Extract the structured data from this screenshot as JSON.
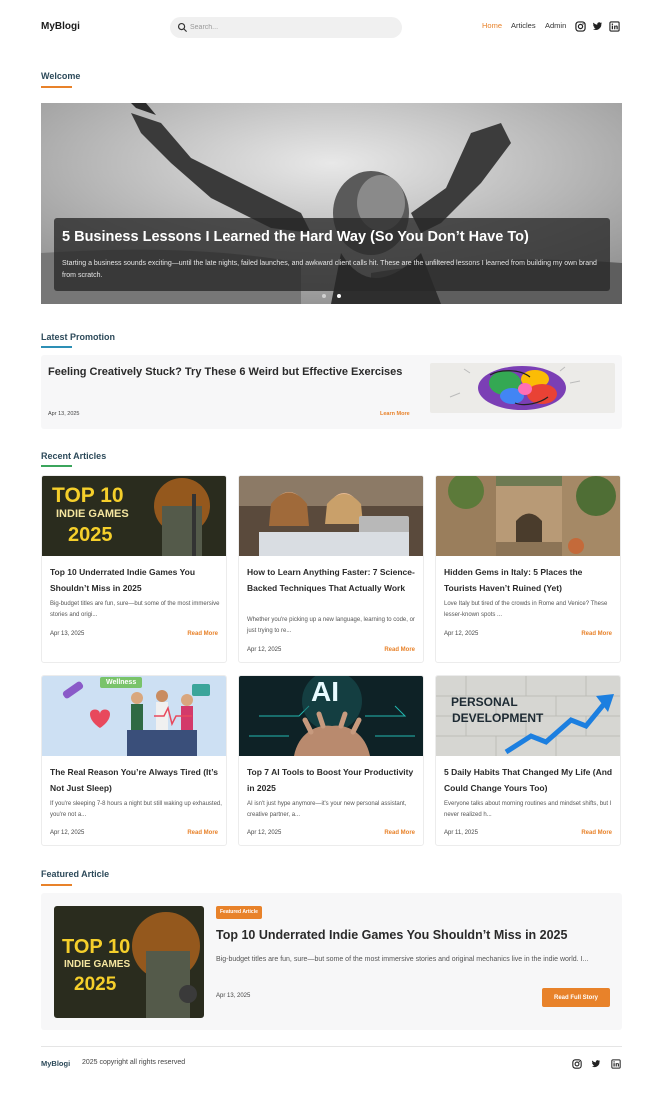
{
  "header": {
    "logo": "MyBlogi",
    "search_placeholder": "Search...",
    "nav": [
      "Home",
      "Articles",
      "Admin"
    ],
    "active_nav": "Home",
    "social_icons": [
      "instagram-icon",
      "twitter-icon",
      "linkedin-icon"
    ]
  },
  "colors": {
    "accent": "#e8822a",
    "heading": "#2d4a5a",
    "green": "#3ba55c"
  },
  "welcome": {
    "heading": "Welcome",
    "hero": {
      "title": "5 Business Lessons I Learned the Hard Way (So You Don’t Have To)",
      "text": "Starting a business sounds exciting—until the late nights, failed launches, and awkward client calls hit. These are the unfiltered lessons I learned from building my own brand from scratch.",
      "slides": 2,
      "active_slide": 2
    }
  },
  "promotion": {
    "heading": "Latest Promotion",
    "title": "Feeling Creatively Stuck? Try These 6 Weird but Effective Exercises",
    "date": "Apr 13, 2025",
    "link": "Learn More"
  },
  "recent": {
    "heading": "Recent Articles",
    "articles": [
      {
        "title": "Top 10 Underrated Indie Games You Shouldn’t Miss in 2025",
        "excerpt": "Big-budget titles are fun, sure—but some of the most immersive stories and origi...",
        "date": "Apr 13, 2025",
        "link": "Read More",
        "thumb_text_1": "TOP 10",
        "thumb_text_2": "INDIE GAMES",
        "thumb_text_3": "2025"
      },
      {
        "title": "How to Learn Anything Faster: 7 Science-Backed Techniques That Actually Work",
        "excerpt": "Whether you're picking up a new language, learning to code, or just trying to re...",
        "date": "Apr 12, 2025",
        "link": "Read More"
      },
      {
        "title": "Hidden Gems in Italy: 5 Places the Tourists Haven’t Ruined (Yet)",
        "excerpt": "Love Italy but tired of the crowds in Rome and Venice? These lesser-known spots ...",
        "date": "Apr 12, 2025",
        "link": "Read More"
      },
      {
        "title": "The Real Reason You’re Always Tired (It’s Not Just Sleep)",
        "excerpt": "If you're sleeping 7-8 hours a night but still waking up exhausted, you're not a...",
        "date": "Apr 12, 2025",
        "link": "Read More",
        "thumb_text_1": "Wellness"
      },
      {
        "title": "Top 7 AI Tools to Boost Your Productivity in 2025",
        "excerpt": "AI isn't just hype anymore—it's your new personal assistant, creative partner, a...",
        "date": "Apr 12, 2025",
        "link": "Read More",
        "thumb_text_1": "AI"
      },
      {
        "title": "5 Daily Habits That Changed My Life (And Could Change Yours Too)",
        "excerpt": "Everyone talks about morning routines and mindset shifts, but I never realized h...",
        "date": "Apr 11, 2025",
        "link": "Read More",
        "thumb_text_1": "PERSONAL",
        "thumb_text_2": "DEVELOPMENT"
      }
    ]
  },
  "featured": {
    "heading": "Featured Article",
    "badge": "Featured Article",
    "title": "Top 10 Underrated Indie Games You Shouldn’t Miss in 2025",
    "excerpt": "Big-budget titles are fun, sure—but some of the most immersive stories and original mechanics live in the indie world. I...",
    "date": "Apr 13, 2025",
    "button": "Read Full Story",
    "thumb_text_1": "TOP 10",
    "thumb_text_2": "INDIE GAMES",
    "thumb_text_3": "2025"
  },
  "footer": {
    "logo": "MyBlogi",
    "copyright": "2025 copyright all rights reserved"
  }
}
